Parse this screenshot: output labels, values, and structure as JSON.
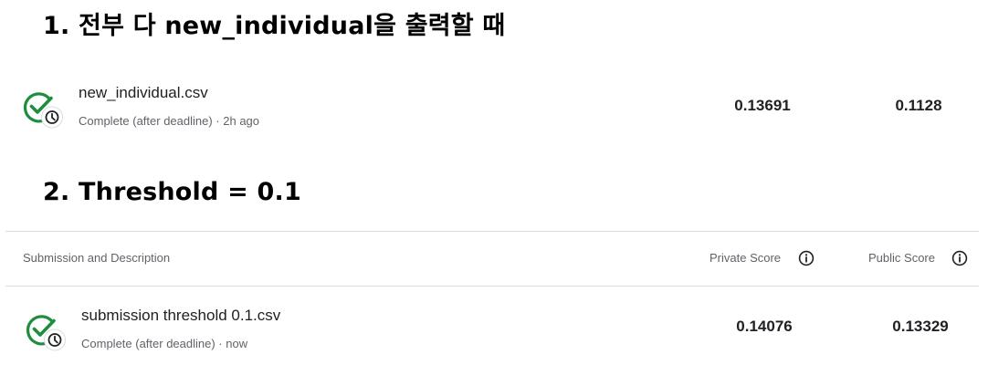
{
  "headings": {
    "all_output": "1. 전부 다 new_individual을 출력할 때",
    "threshold": "2. Threshold = 0.1"
  },
  "table": {
    "columns": {
      "description": "Submission and Description",
      "private_score": "Private Score",
      "public_score": "Public Score"
    }
  },
  "submissions": [
    {
      "name": "new_individual.csv",
      "status": "Complete (after deadline) · 2h ago",
      "private_score": "0.13691",
      "public_score": "0.1128",
      "icon": "check-circle-clock-icon"
    },
    {
      "name": "submission threshold 0.1.csv",
      "status": "Complete (after deadline) · now",
      "private_score": "0.14076",
      "public_score": "0.13329",
      "icon": "check-circle-clock-icon"
    }
  ],
  "colors": {
    "success_green": "#1e8e3e",
    "divider": "#dadce0",
    "secondary_text": "#5f6368"
  }
}
